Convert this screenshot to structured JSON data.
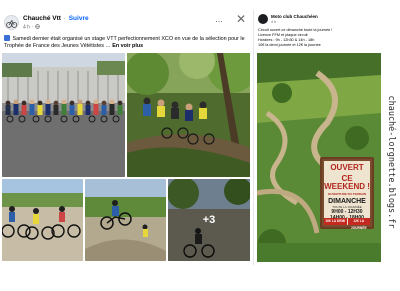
{
  "post": {
    "author": "Chauché Vtt",
    "separator": "·",
    "follow_label": "Suivre",
    "time": "4 h",
    "more_label": "···",
    "close_label": "✕",
    "text_main": "Samedi dernier était organisé un stage VTT perfectionnement XCO en vue de la sélection pour le Trophée de France des Jeunes Vététistes",
    "text_ellipsis": " … ",
    "see_more": "En voir plus",
    "more_photos": "+3"
  },
  "right_post": {
    "page_name": "Moto club Chauchéen",
    "time": "4 h ·",
    "lines": [
      "Circuit ouvert ce dimanche toute la journée !",
      "Licence FFM et plaque circuit",
      "Horaires : 9h - 12h30 & 14h - 18h",
      "10€ la demi journée et 12€ la journée"
    ],
    "sign": {
      "title_line1": "OUVERT",
      "title_line2": "CE WEEKEND !",
      "subtitle": "OUVERTURE DU TERRAIN",
      "day": "DIMANCHE",
      "day_note": "TOUTE LA JOURNÉE",
      "hours_morning": "9H00 - 12H30",
      "hours_afternoon": "14H00 - 18H00",
      "price_half": "10€ LA DEMI",
      "price_full": "12€ LA JOURNÉE"
    }
  },
  "watermark": "chauché-lorgnette.blogs.fr",
  "colors": {
    "link_blue": "#0866ff",
    "secondary_text": "#65676b",
    "sign_red": "#b1271e"
  }
}
